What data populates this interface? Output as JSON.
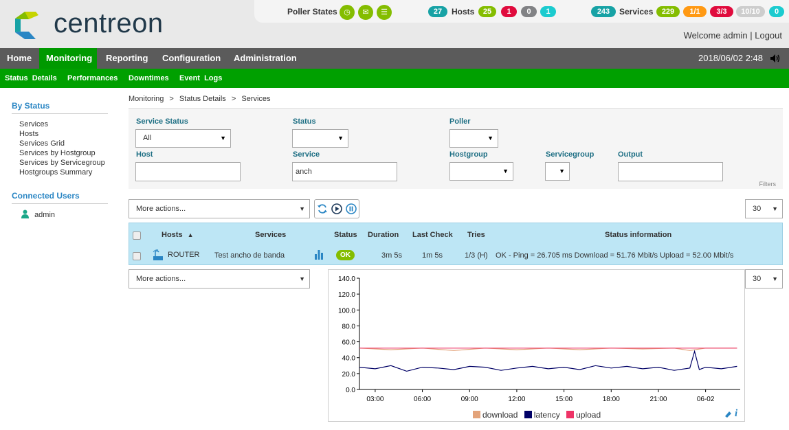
{
  "brand": {
    "name": "centreon"
  },
  "status_strip": {
    "poller_label": "Poller States",
    "hosts_label": "Hosts",
    "hosts_total": "27",
    "hosts_up": "25",
    "hosts_down": "1",
    "hosts_unreachable": "0",
    "hosts_pending": "1",
    "services_label": "Services",
    "services_total": "243",
    "services_ok": "229",
    "services_warning": "1/1",
    "services_critical": "3/3",
    "services_unknown": "10/10",
    "services_pending": "0",
    "colors": {
      "teal": "#17a2a5",
      "green": "#84bd00",
      "red": "#e00b3d",
      "grey": "#818285",
      "cyan": "#1bcbcf",
      "orange": "#ff9913",
      "lightgrey": "#cdcdcd"
    }
  },
  "user": {
    "welcome": "Welcome admin",
    "sep": "|",
    "logout": "Logout"
  },
  "mainnav": {
    "items": [
      "Home",
      "Monitoring",
      "Reporting",
      "Configuration",
      "Administration"
    ],
    "active": "Monitoring",
    "datetime": "2018/06/02 2:48"
  },
  "subnav": {
    "items": [
      "Status  Details",
      "Performances",
      "Downtimes",
      "Event  Logs"
    ]
  },
  "sidebar": {
    "by_status_title": "By Status",
    "links": [
      "Services",
      "Hosts",
      "Services Grid",
      "Services by Hostgroup",
      "Services by Servicegroup",
      "Hostgroups Summary"
    ],
    "connected_title": "Connected Users",
    "user": "admin"
  },
  "breadcrumb": {
    "a": "Monitoring",
    "b": "Status Details",
    "c": "Services",
    "sep": ">"
  },
  "filters": {
    "service_status_label": "Service Status",
    "service_status_value": "All",
    "status_label": "Status",
    "status_value": "",
    "poller_label": "Poller",
    "poller_value": "",
    "host_label": "Host",
    "host_value": "",
    "service_label": "Service",
    "service_value": "anch",
    "hostgroup_label": "Hostgroup",
    "hostgroup_value": "",
    "servicegroup_label": "Servicegroup",
    "servicegroup_value": "",
    "output_label": "Output",
    "output_value": "",
    "filters_link": "Filters"
  },
  "actions": {
    "more_actions": "More actions...",
    "per_page": "30"
  },
  "table": {
    "headers": {
      "hosts": "Hosts",
      "services": "Services",
      "status": "Status",
      "duration": "Duration",
      "last_check": "Last Check",
      "tries": "Tries",
      "status_info": "Status information"
    },
    "rows": [
      {
        "host": "ROUTER",
        "service": "Test ancho de banda",
        "status": "OK",
        "duration": "3m 5s",
        "last_check": "1m 5s",
        "tries": "1/3 (H)",
        "info": "OK - Ping = 26.705 ms Download = 51.76 Mbit/s Upload = 52.00 Mbit/s"
      }
    ]
  },
  "chart_data": {
    "type": "line",
    "ylim": [
      0,
      140
    ],
    "yticks": [
      "0.0",
      "20.0",
      "40.0",
      "60.0",
      "80.0",
      "100.0",
      "120.0",
      "140.0"
    ],
    "xticks": [
      "03:00",
      "06:00",
      "09:00",
      "12:00",
      "15:00",
      "18:00",
      "21:00",
      "06-02"
    ],
    "xtick_hours": [
      3,
      6,
      9,
      12,
      15,
      18,
      21,
      24
    ],
    "xlim_hours": [
      2.0,
      26.2
    ],
    "series": [
      {
        "name": "download",
        "color": "#e3a37a",
        "hours": [
          2,
          4,
          6,
          8,
          10,
          12,
          14,
          16,
          18,
          20,
          22,
          23,
          24,
          26
        ],
        "values": [
          52,
          50,
          52,
          49,
          52,
          50,
          52,
          50,
          52,
          51,
          52,
          49,
          52,
          52
        ]
      },
      {
        "name": "latency",
        "color": "#000066",
        "hours": [
          2,
          3,
          4,
          5,
          6,
          7,
          8,
          9,
          10,
          11,
          12,
          13,
          14,
          15,
          16,
          17,
          18,
          19,
          20,
          21,
          22,
          23,
          23.3,
          23.6,
          24,
          25,
          26
        ],
        "values": [
          28,
          26,
          30,
          23,
          28,
          27,
          25,
          29,
          28,
          24,
          27,
          29,
          26,
          28,
          25,
          30,
          27,
          29,
          26,
          28,
          24,
          27,
          48,
          25,
          28,
          26,
          29
        ]
      },
      {
        "name": "upload",
        "color": "#ee3366",
        "hours": [
          2,
          6,
          10,
          14,
          18,
          22,
          26
        ],
        "values": [
          52,
          52,
          52,
          52,
          52,
          52,
          52
        ]
      }
    ]
  }
}
